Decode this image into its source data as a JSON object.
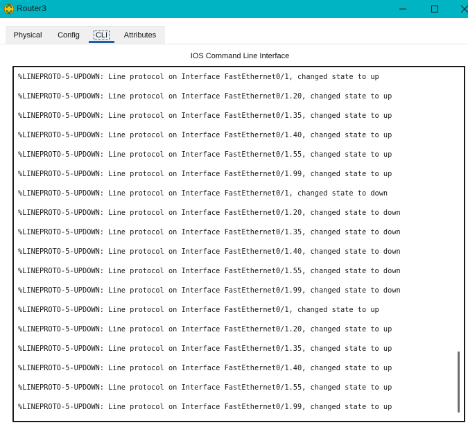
{
  "window": {
    "title": "Router3",
    "icon": "router-app-icon",
    "controls": {
      "minimize_icon": "minimize-icon",
      "maximize_icon": "maximize-icon",
      "close_icon": "close-icon"
    }
  },
  "tabs": [
    {
      "label": "Physical",
      "active": false
    },
    {
      "label": "Config",
      "active": false
    },
    {
      "label": "CLI",
      "active": true
    },
    {
      "label": "Attributes",
      "active": false
    }
  ],
  "section_title": "IOS Command Line Interface",
  "cli": {
    "lines": [
      "%LINEPROTO-5-UPDOWN: Line protocol on Interface FastEthernet0/1, changed state to up",
      "%LINEPROTO-5-UPDOWN: Line protocol on Interface FastEthernet0/1.20, changed state to up",
      "%LINEPROTO-5-UPDOWN: Line protocol on Interface FastEthernet0/1.35, changed state to up",
      "%LINEPROTO-5-UPDOWN: Line protocol on Interface FastEthernet0/1.40, changed state to up",
      "%LINEPROTO-5-UPDOWN: Line protocol on Interface FastEthernet0/1.55, changed state to up",
      "%LINEPROTO-5-UPDOWN: Line protocol on Interface FastEthernet0/1.99, changed state to up",
      "%LINEPROTO-5-UPDOWN: Line protocol on Interface FastEthernet0/1, changed state to down",
      "%LINEPROTO-5-UPDOWN: Line protocol on Interface FastEthernet0/1.20, changed state to down",
      "%LINEPROTO-5-UPDOWN: Line protocol on Interface FastEthernet0/1.35, changed state to down",
      "%LINEPROTO-5-UPDOWN: Line protocol on Interface FastEthernet0/1.40, changed state to down",
      "%LINEPROTO-5-UPDOWN: Line protocol on Interface FastEthernet0/1.55, changed state to down",
      "%LINEPROTO-5-UPDOWN: Line protocol on Interface FastEthernet0/1.99, changed state to down",
      "%LINEPROTO-5-UPDOWN: Line protocol on Interface FastEthernet0/1, changed state to up",
      "%LINEPROTO-5-UPDOWN: Line protocol on Interface FastEthernet0/1.20, changed state to up",
      "%LINEPROTO-5-UPDOWN: Line protocol on Interface FastEthernet0/1.35, changed state to up",
      "%LINEPROTO-5-UPDOWN: Line protocol on Interface FastEthernet0/1.40, changed state to up",
      "%LINEPROTO-5-UPDOWN: Line protocol on Interface FastEthernet0/1.55, changed state to up",
      "%LINEPROTO-5-UPDOWN: Line protocol on Interface FastEthernet0/1.99, changed state to up"
    ]
  },
  "colors": {
    "titlebar": "#00b4c4",
    "active_tab_underline": "#1f5fa8",
    "terminal_border": "#1a1a1a"
  }
}
